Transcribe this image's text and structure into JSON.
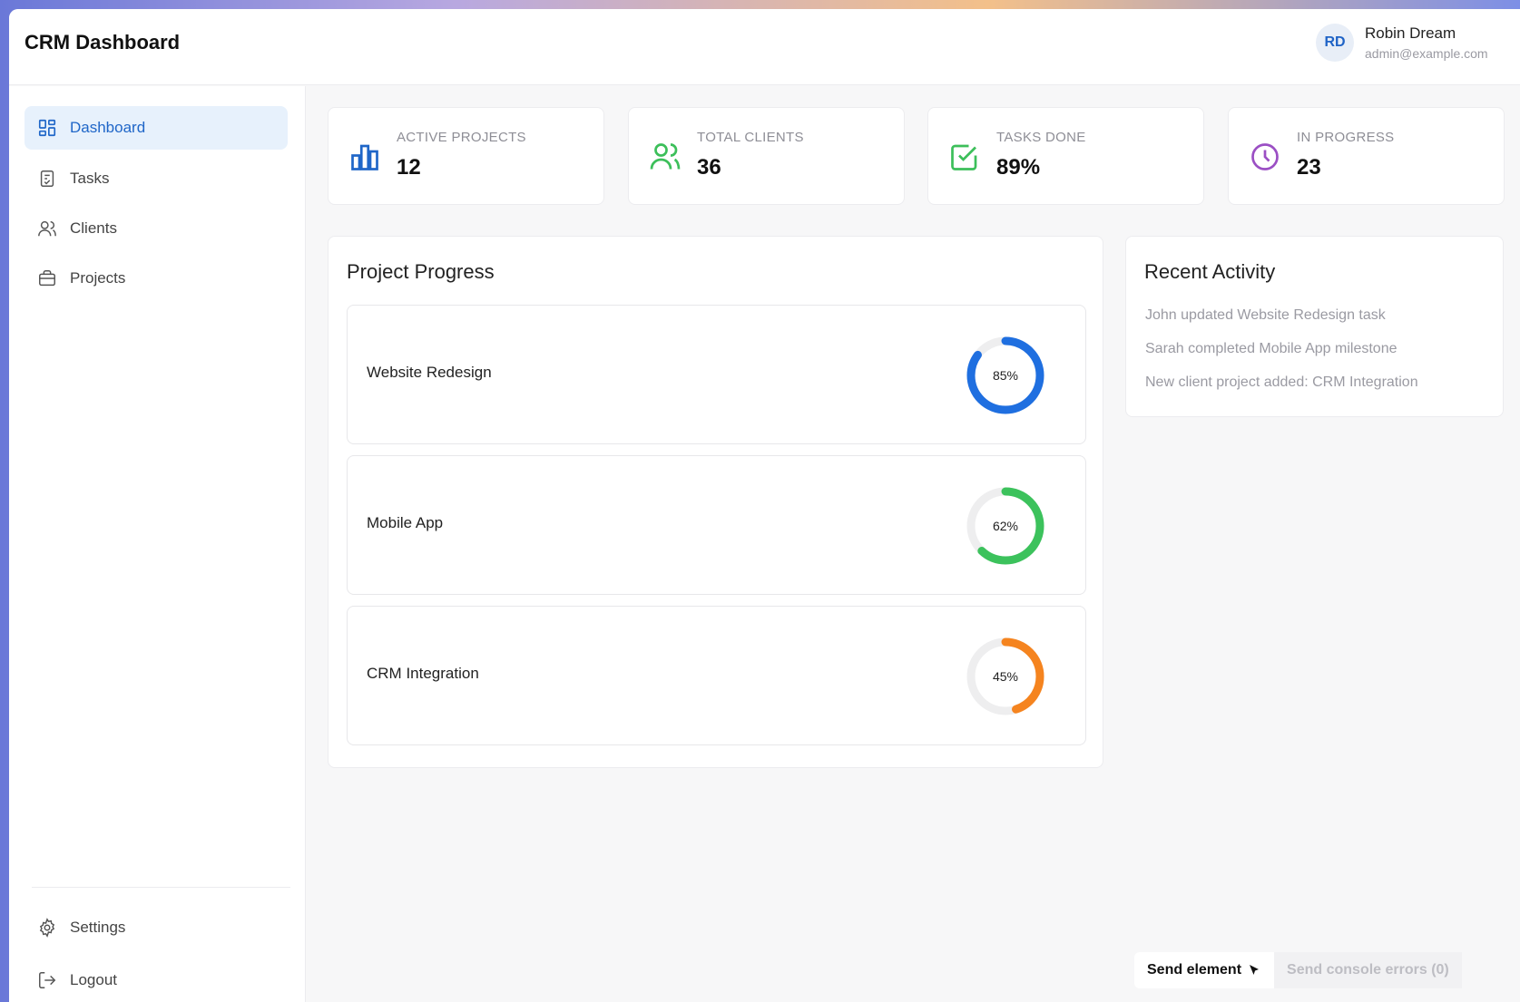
{
  "header": {
    "title": "CRM Dashboard",
    "user": {
      "initials": "RD",
      "name": "Robin Dream",
      "email": "admin@example.com"
    }
  },
  "sidebar": {
    "items": [
      {
        "label": "Dashboard",
        "icon": "dashboard-icon",
        "active": true
      },
      {
        "label": "Tasks",
        "icon": "tasks-icon",
        "active": false
      },
      {
        "label": "Clients",
        "icon": "clients-icon",
        "active": false
      },
      {
        "label": "Projects",
        "icon": "briefcase-icon",
        "active": false
      }
    ],
    "bottom_items": [
      {
        "label": "Settings",
        "icon": "gear-icon"
      },
      {
        "label": "Logout",
        "icon": "logout-icon"
      }
    ]
  },
  "stats": [
    {
      "label": "ACTIVE PROJECTS",
      "value": "12",
      "icon": "bar-chart-icon",
      "color": "#1f66c8"
    },
    {
      "label": "TOTAL CLIENTS",
      "value": "36",
      "icon": "users-icon",
      "color": "#3cbf5a"
    },
    {
      "label": "TASKS DONE",
      "value": "89%",
      "icon": "check-square-icon",
      "color": "#3cbf5a"
    },
    {
      "label": "IN PROGRESS",
      "value": "23",
      "icon": "clock-icon",
      "color": "#9b4fc4"
    }
  ],
  "project_progress": {
    "title": "Project Progress",
    "projects": [
      {
        "name": "Website Redesign",
        "percent": 85,
        "percent_label": "85%",
        "color": "#1f6fe0"
      },
      {
        "name": "Mobile App",
        "percent": 62,
        "percent_label": "62%",
        "color": "#3cc25c"
      },
      {
        "name": "CRM Integration",
        "percent": 45,
        "percent_label": "45%",
        "color": "#f5841f"
      }
    ]
  },
  "recent_activity": {
    "title": "Recent Activity",
    "items": [
      "John updated Website Redesign task",
      "Sarah completed Mobile App milestone",
      "New client project added: CRM Integration"
    ]
  },
  "devtools": {
    "send_element": "Send element",
    "send_errors": "Send console errors (0)"
  }
}
